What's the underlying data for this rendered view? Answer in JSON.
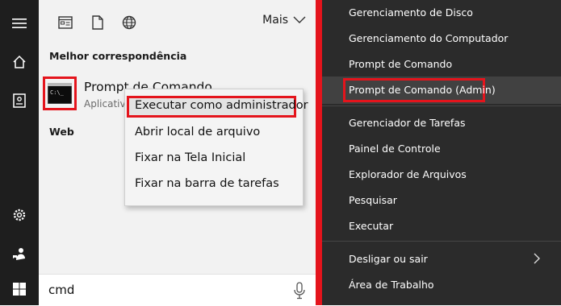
{
  "start": {
    "more_label": "Mais",
    "best_match_heading": "Melhor correspondência",
    "best_match": {
      "name": "Prompt de Comando",
      "type": "Aplicativo",
      "icon": "cmd-icon"
    },
    "web_heading": "Web",
    "context_menu": [
      "Executar como administrador",
      "Abrir local de arquivo",
      "Fixar na Tela Inicial",
      "Fixar na barra de tarefas"
    ],
    "search_query": "cmd"
  },
  "winx_menu": {
    "items": [
      "Gerenciamento de Disco",
      "Gerenciamento do Computador",
      "Prompt de Comando",
      "Prompt de Comando (Admin)",
      "Gerenciador de Tarefas",
      "Painel de Controle",
      "Explorador de Arquivos",
      "Pesquisar",
      "Executar",
      "Desligar ou sair",
      "Área de Trabalho"
    ]
  },
  "colors": {
    "highlight_red": "#e4141c",
    "rail_bg": "#1e1e1e",
    "panel_bg": "#f2f2f2",
    "winx_bg": "#2b2b2b"
  }
}
